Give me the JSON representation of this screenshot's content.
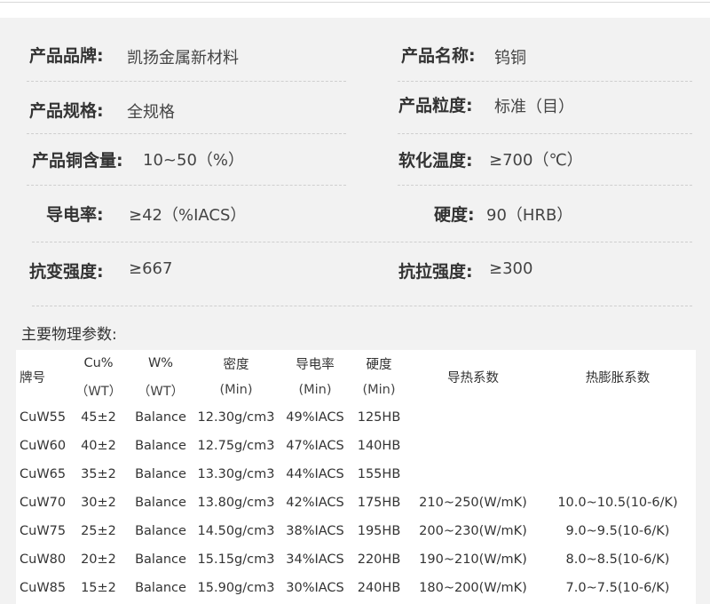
{
  "specs": {
    "brand": {
      "label": "产品品牌:",
      "value": "凯扬金属新材料"
    },
    "name": {
      "label": "产品名称:",
      "value": "钨铜"
    },
    "spec": {
      "label": "产品规格:",
      "value": "全规格"
    },
    "grain": {
      "label": "产品粒度:",
      "value": "标准（目）"
    },
    "copper": {
      "label": "产品铜含量:",
      "value": "10~50（%）"
    },
    "soften": {
      "label": "软化温度:",
      "value": "≥700（℃）"
    },
    "conductivity": {
      "label": "导电率:",
      "value": "≥42（%IACS）"
    },
    "hardness": {
      "label": "硬度:",
      "value": "90（HRB）"
    },
    "tensile": {
      "label": "抗变强度:",
      "value": "≥667"
    },
    "pull": {
      "label": "抗拉强度:",
      "value": "≥300"
    }
  },
  "section_title": "主要物理参数:",
  "table": {
    "headers": {
      "grade": "牌号",
      "cu_top": "Cu%",
      "cu_bottom": "（WT）",
      "w_top": "W%",
      "w_bottom": "（WT）",
      "density_top": "密度",
      "density_bottom": "(Min)",
      "cond_top": "导电率",
      "cond_bottom": "(Min)",
      "hard_top": "硬度",
      "hard_bottom": "(Min)",
      "thermal": "导热系数",
      "expansion": "热膨胀系数"
    },
    "rows": [
      {
        "grade": "CuW55",
        "cu": "45±2",
        "w": "Balance",
        "density": "12.30g/cm3",
        "cond": "49%IACS",
        "hard": "125HB",
        "thermal": "",
        "expansion": ""
      },
      {
        "grade": "CuW60",
        "cu": "40±2",
        "w": "Balance",
        "density": "12.75g/cm3",
        "cond": "47%IACS",
        "hard": "140HB",
        "thermal": "",
        "expansion": ""
      },
      {
        "grade": "CuW65",
        "cu": "35±2",
        "w": "Balance",
        "density": "13.30g/cm3",
        "cond": "44%IACS",
        "hard": "155HB",
        "thermal": "",
        "expansion": ""
      },
      {
        "grade": "CuW70",
        "cu": "30±2",
        "w": "Balance",
        "density": "13.80g/cm3",
        "cond": "42%IACS",
        "hard": "175HB",
        "thermal": "210~250(W/mK)",
        "expansion": "10.0~10.5(10-6/K)"
      },
      {
        "grade": "CuW75",
        "cu": "25±2",
        "w": "Balance",
        "density": "14.50g/cm3",
        "cond": "38%IACS",
        "hard": "195HB",
        "thermal": "200~230(W/mK)",
        "expansion": "9.0~9.5(10-6/K)"
      },
      {
        "grade": "CuW80",
        "cu": "20±2",
        "w": "Balance",
        "density": "15.15g/cm3",
        "cond": "34%IACS",
        "hard": "220HB",
        "thermal": "190~210(W/mK)",
        "expansion": "8.0~8.5(10-6/K)"
      },
      {
        "grade": "CuW85",
        "cu": "15±2",
        "w": "Balance",
        "density": "15.90g/cm3",
        "cond": "30%IACS",
        "hard": "240HB",
        "thermal": "180~200(W/mK)",
        "expansion": "7.0~7.5(10-6/K)"
      }
    ]
  }
}
